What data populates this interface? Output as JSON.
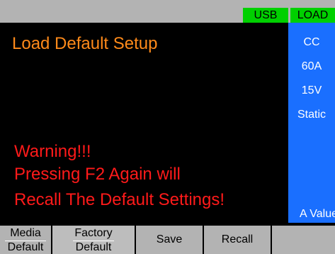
{
  "status": {
    "usb": "USB",
    "load": "LOAD"
  },
  "main": {
    "title": "Load Default Setup",
    "warning_line1": "Warning!!!",
    "warning_line2": "Pressing F2 Again will",
    "warning_line3": "Recall The Default Settings!"
  },
  "side": {
    "mode": "CC",
    "current": "60A",
    "voltage": "15V",
    "static": "Static",
    "value": "A Value"
  },
  "softkeys": {
    "media_top": "Media",
    "media_bottom": "Default",
    "factory_top": "Factory",
    "factory_bottom": "Default",
    "save": "Save",
    "recall": "Recall"
  },
  "colors": {
    "status_green": "#00d000",
    "title_orange": "#ff8a1a",
    "warning_red": "#ff1a1a",
    "side_blue": "#1a6fff",
    "key_gray": "#b3b3b3"
  }
}
